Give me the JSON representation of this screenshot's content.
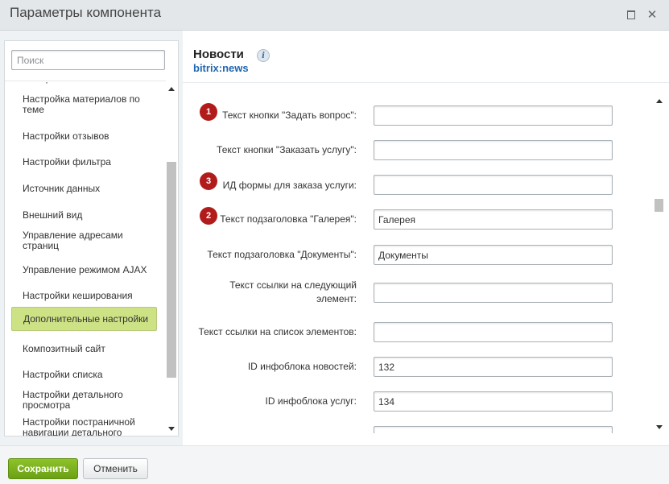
{
  "window": {
    "title": "Параметры компонента"
  },
  "sidebar": {
    "search_placeholder": "Поиск",
    "items": [
      {
        "label": "Настройка материалов по теме"
      },
      {
        "label": "Настройки отзывов"
      },
      {
        "label": "Настройки фильтра"
      },
      {
        "label": "Источник данных"
      },
      {
        "label": "Внешний вид"
      },
      {
        "label": "Управление адресами страниц"
      },
      {
        "label": "Управление режимом AJAX"
      },
      {
        "label": "Настройки кеширования"
      },
      {
        "label": "Дополнительные настройки",
        "active": true
      },
      {
        "label": "Композитный сайт"
      },
      {
        "label": "Настройки списка"
      },
      {
        "label": "Настройки детального просмотра"
      },
      {
        "label": "Настройки постраничной навигации детального"
      }
    ]
  },
  "component": {
    "name": "Новости",
    "code": "bitrix:news"
  },
  "form": {
    "rows": [
      {
        "label": "Текст кнопки \"Задать вопрос\":",
        "value": "",
        "badge": "1"
      },
      {
        "label": "Текст кнопки \"Заказать услугу\":",
        "value": ""
      },
      {
        "label": "ИД формы для заказа услуги:",
        "value": "",
        "badge": "3"
      },
      {
        "label": "Текст подзаголовка \"Галерея\":",
        "value": "Галерея",
        "badge": "2"
      },
      {
        "label": "Текст подзаголовка \"Документы\":",
        "value": "Документы"
      },
      {
        "label": "Текст ссылки на следующий элемент:",
        "value": ""
      },
      {
        "label": "Текст ссылки на список элементов:",
        "value": ""
      },
      {
        "label": "ID инфоблока новостей:",
        "value": "132"
      },
      {
        "label": "ID инфоблока услуг:",
        "value": "134"
      }
    ]
  },
  "footer": {
    "save_label": "Сохранить",
    "cancel_label": "Отменить"
  },
  "colors": {
    "accent_green": "#6aa014",
    "active_item": "#cde185",
    "badge_red": "#b21b1b",
    "link_blue": "#2067b0"
  }
}
